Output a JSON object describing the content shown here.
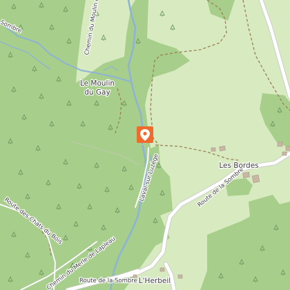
{
  "map": {
    "place_labels": {
      "moulin": [
        "Le Moulin",
        "du Gay"
      ],
      "bordes": "Les Bordes",
      "herbeil": "L'Herbeil"
    },
    "road_labels": {
      "chemin_moulin": "Chemin du Moulin du Gay",
      "laval": "Laval-sur-Luzège",
      "route_sombre_east": "Route de la Sombre",
      "route_sombre_south": "Route de la Sombre",
      "route_chats": "Route des Chats du Bois",
      "chemin_lapleau": "Chemin du Merle de Lapleau",
      "sombre_nw": "Sombre"
    },
    "marker": {
      "icon": "location-pin-icon",
      "color": "#f06a2c"
    },
    "colors": {
      "meadow": "#d7eac0",
      "forest": "#a7ce8b",
      "water": "#8db3d5",
      "road": "#ffffff",
      "track": "#9b7e55",
      "building": "#c8b7a4"
    }
  }
}
